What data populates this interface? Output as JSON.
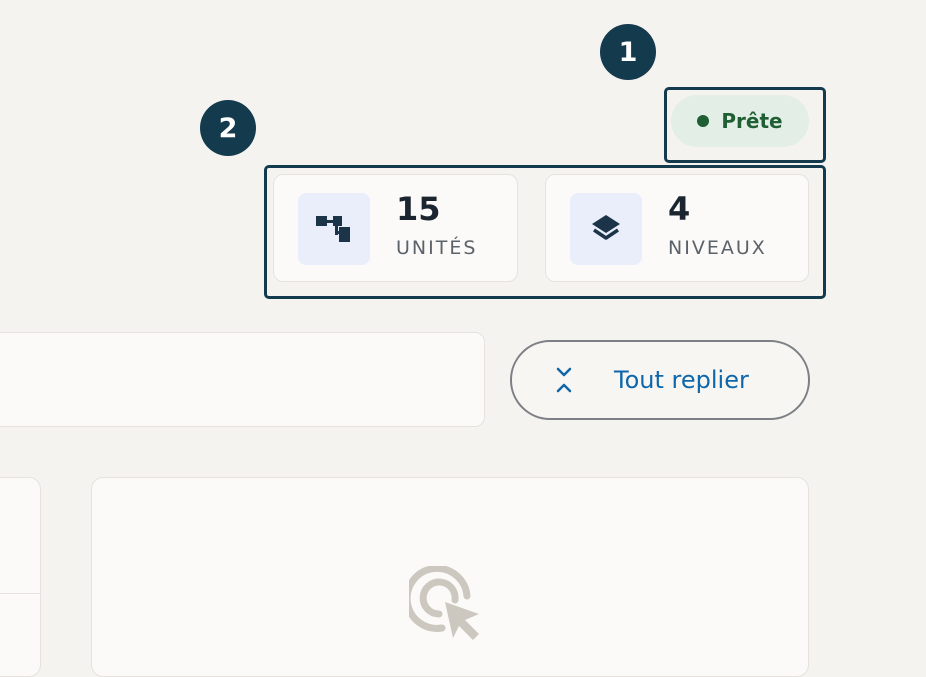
{
  "callouts": {
    "first": "1",
    "second": "2"
  },
  "status": {
    "label": "Prête",
    "color": "#1f5f33"
  },
  "stats": [
    {
      "value": "15",
      "label": "UNITÉS",
      "icon": "hierarchy-icon"
    },
    {
      "value": "4",
      "label": "NIVEAUX",
      "icon": "layers-icon"
    }
  ],
  "toolbar": {
    "collapse_label": "Tout replier",
    "collapse_icon": "collapse-arrows-icon"
  },
  "detail_panel": {
    "icon": "cursor-click-icon"
  },
  "colors": {
    "accent": "#143a4e",
    "link": "#0f67ab",
    "status_bg": "#e3efe6"
  }
}
